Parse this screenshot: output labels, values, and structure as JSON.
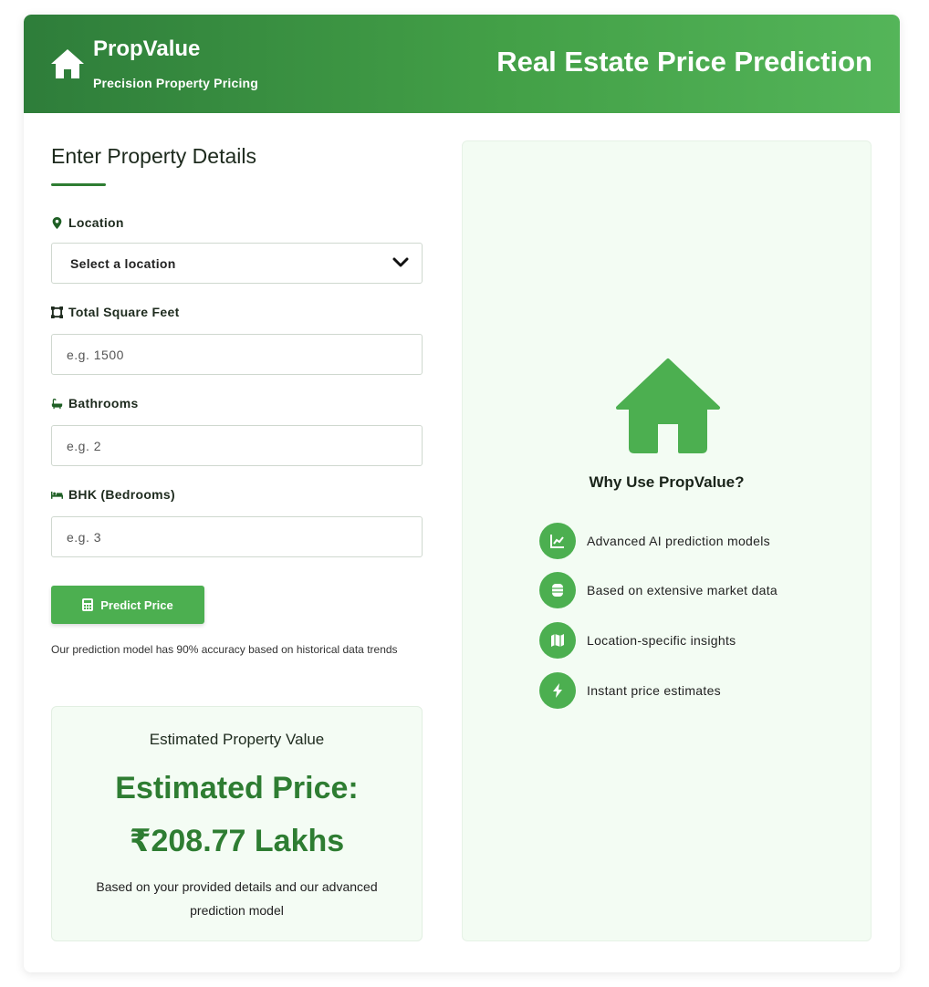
{
  "header": {
    "brand": "PropValue",
    "tagline": "Precision Property Pricing",
    "title": "Real Estate Price Prediction",
    "logo_icon": "house-icon"
  },
  "form": {
    "title": "Enter Property Details",
    "location": {
      "label": "Location",
      "icon": "map-pin-icon",
      "selected": "Select a location"
    },
    "sqft": {
      "label": "Total Square Feet",
      "icon": "square-icon",
      "placeholder": "e.g. 1500"
    },
    "bath": {
      "label": "Bathrooms",
      "icon": "bathtub-icon",
      "placeholder": "e.g. 2"
    },
    "bhk": {
      "label": "BHK (Bedrooms)",
      "icon": "bed-icon",
      "placeholder": "e.g. 3"
    },
    "button": {
      "label": "Predict Price",
      "icon": "calculator-icon"
    },
    "note": "Our prediction model has 90% accuracy based on historical data trends"
  },
  "result": {
    "heading": "Estimated Property Value",
    "price_label": "Estimated Price:",
    "price_value": "₹208.77 Lakhs",
    "description": "Based on your provided details and our advanced prediction model"
  },
  "info": {
    "heading": "Why Use PropValue?",
    "features": [
      {
        "label": "Advanced AI prediction models",
        "icon": "chart-line-icon"
      },
      {
        "label": "Based on extensive market data",
        "icon": "database-icon"
      },
      {
        "label": "Location-specific insights",
        "icon": "map-icon"
      },
      {
        "label": "Instant price estimates",
        "icon": "bolt-icon"
      }
    ]
  },
  "colors": {
    "primary": "#4caf50",
    "dark_green": "#2e7d32",
    "panel_bg": "#f3fcf3"
  }
}
